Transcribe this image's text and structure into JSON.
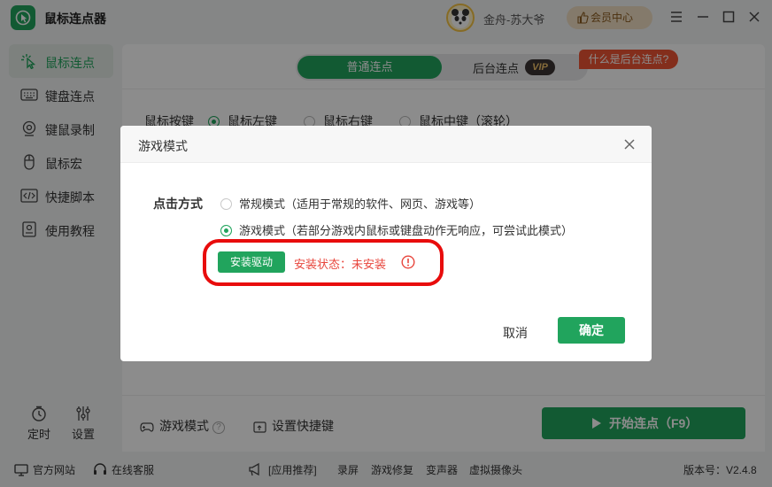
{
  "app": {
    "title": "鼠标连点器"
  },
  "user": {
    "name": "金舟-苏大爷",
    "vip_label": "会员中心"
  },
  "sidebar": {
    "items": [
      {
        "label": "鼠标连点",
        "icon": "cursor-click-icon"
      },
      {
        "label": "键盘连点",
        "icon": "keyboard-icon"
      },
      {
        "label": "键鼠录制",
        "icon": "record-icon"
      },
      {
        "label": "鼠标宏",
        "icon": "mouse-icon"
      },
      {
        "label": "快捷脚本",
        "icon": "script-icon"
      },
      {
        "label": "使用教程",
        "icon": "tutorial-icon"
      }
    ],
    "timer_label": "定时",
    "settings_label": "设置"
  },
  "main": {
    "tab_normal": "普通连点",
    "tab_background": "后台连点",
    "vip_tag": "VIP",
    "what_is_background": "什么是后台连点?",
    "mouse_button_label": "鼠标按键",
    "mouse_options": [
      "鼠标左键",
      "鼠标右键",
      "鼠标中键（滚轮）"
    ],
    "game_mode_label": "游戏模式",
    "shortcut_label": "设置快捷键",
    "start_label": "开始连点（F9）"
  },
  "statusbar": {
    "website": "官方网站",
    "support": "在线客服",
    "app_recommend": "[应用推荐]",
    "links": [
      "录屏",
      "游戏修复",
      "变声器",
      "虚拟摄像头"
    ],
    "version": "版本号：V2.4.8"
  },
  "dialog": {
    "title": "游戏模式",
    "click_mode_label": "点击方式",
    "option_normal": "常规模式（适用于常规的软件、网页、游戏等）",
    "option_game": "游戏模式（若部分游戏内鼠标或键盘动作无响应，可尝试此模式）",
    "selected_option": "游戏模式",
    "install_driver": "安装驱动",
    "install_status": "安装状态：未安装",
    "cancel": "取消",
    "confirm": "确定"
  },
  "colors": {
    "accent": "#21a45d",
    "warning": "#e8463d",
    "highlight": "#e80c0c"
  }
}
